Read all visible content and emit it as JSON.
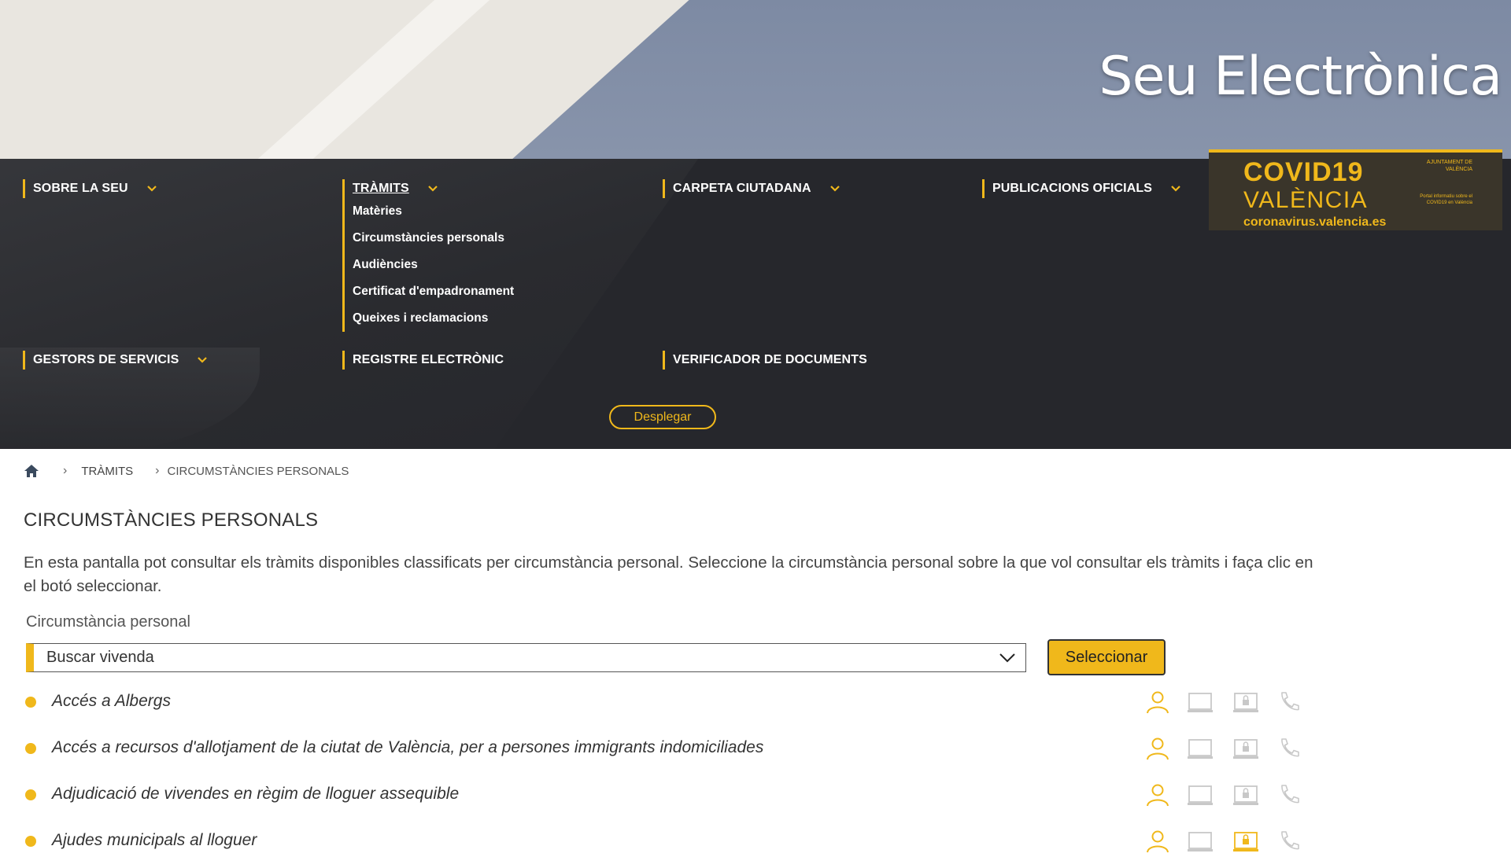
{
  "hero": {
    "title": "Seu Electrònica"
  },
  "nav": {
    "sobre": "SOBRE LA SEU",
    "tramits": "TRÀMITS",
    "tramits_items": [
      "Matèries",
      "Circumstàncies personals",
      "Audiències",
      "Certificat d'empadronament",
      "Queixes i reclamacions"
    ],
    "carpeta": "CARPETA CIUTADANA",
    "publicacions": "PUBLICACIONS OFICIALS",
    "gestors": "GESTORS DE SERVICIS",
    "registre": "REGISTRE ELECTRÒNIC",
    "verificador": "VERIFICADOR DE DOCUMENTS",
    "desplegar": "Desplegar"
  },
  "covid": {
    "line1": "COVID19",
    "line2": "VALÈNCIA",
    "line3": "coronavirus.valencia.es",
    "org": "AJUNTAMENT DE VALÈNCIA",
    "note": "Portal informatiu sobre el COVID19 en València"
  },
  "breadcrumb": {
    "level1": "TRÀMITS",
    "level2": "CIRCUMSTÀNCIES PERSONALS"
  },
  "page": {
    "title": "CIRCUMSTÀNCIES PERSONALS",
    "intro": "En esta pantalla pot consultar els tràmits disponibles classificats per circumstància personal. Seleccione la circumstància personal sobre la que vol consultar els tràmits i faça clic en el botó seleccionar.",
    "field_label": "Circumstància personal",
    "selected": "Buscar vivenda",
    "button": "Seleccionar"
  },
  "procedures": [
    {
      "title": "Accés a Albergs",
      "presencial": true,
      "online": false,
      "cert": false,
      "phone": false
    },
    {
      "title": "Accés a recursos d'allotjament de la ciutat de València, per a persones immigrants indomiciliades",
      "presencial": true,
      "online": false,
      "cert": false,
      "phone": false
    },
    {
      "title": "Adjudicació de vivendes en règim de lloguer assequible",
      "presencial": true,
      "online": false,
      "cert": false,
      "phone": false
    },
    {
      "title": "Ajudes municipals al lloguer",
      "presencial": true,
      "online": false,
      "cert": true,
      "phone": false
    }
  ],
  "colors": {
    "accent": "#f0b81b",
    "nav_bg": "#26272c",
    "icon_inactive": "#c8c8c8"
  }
}
